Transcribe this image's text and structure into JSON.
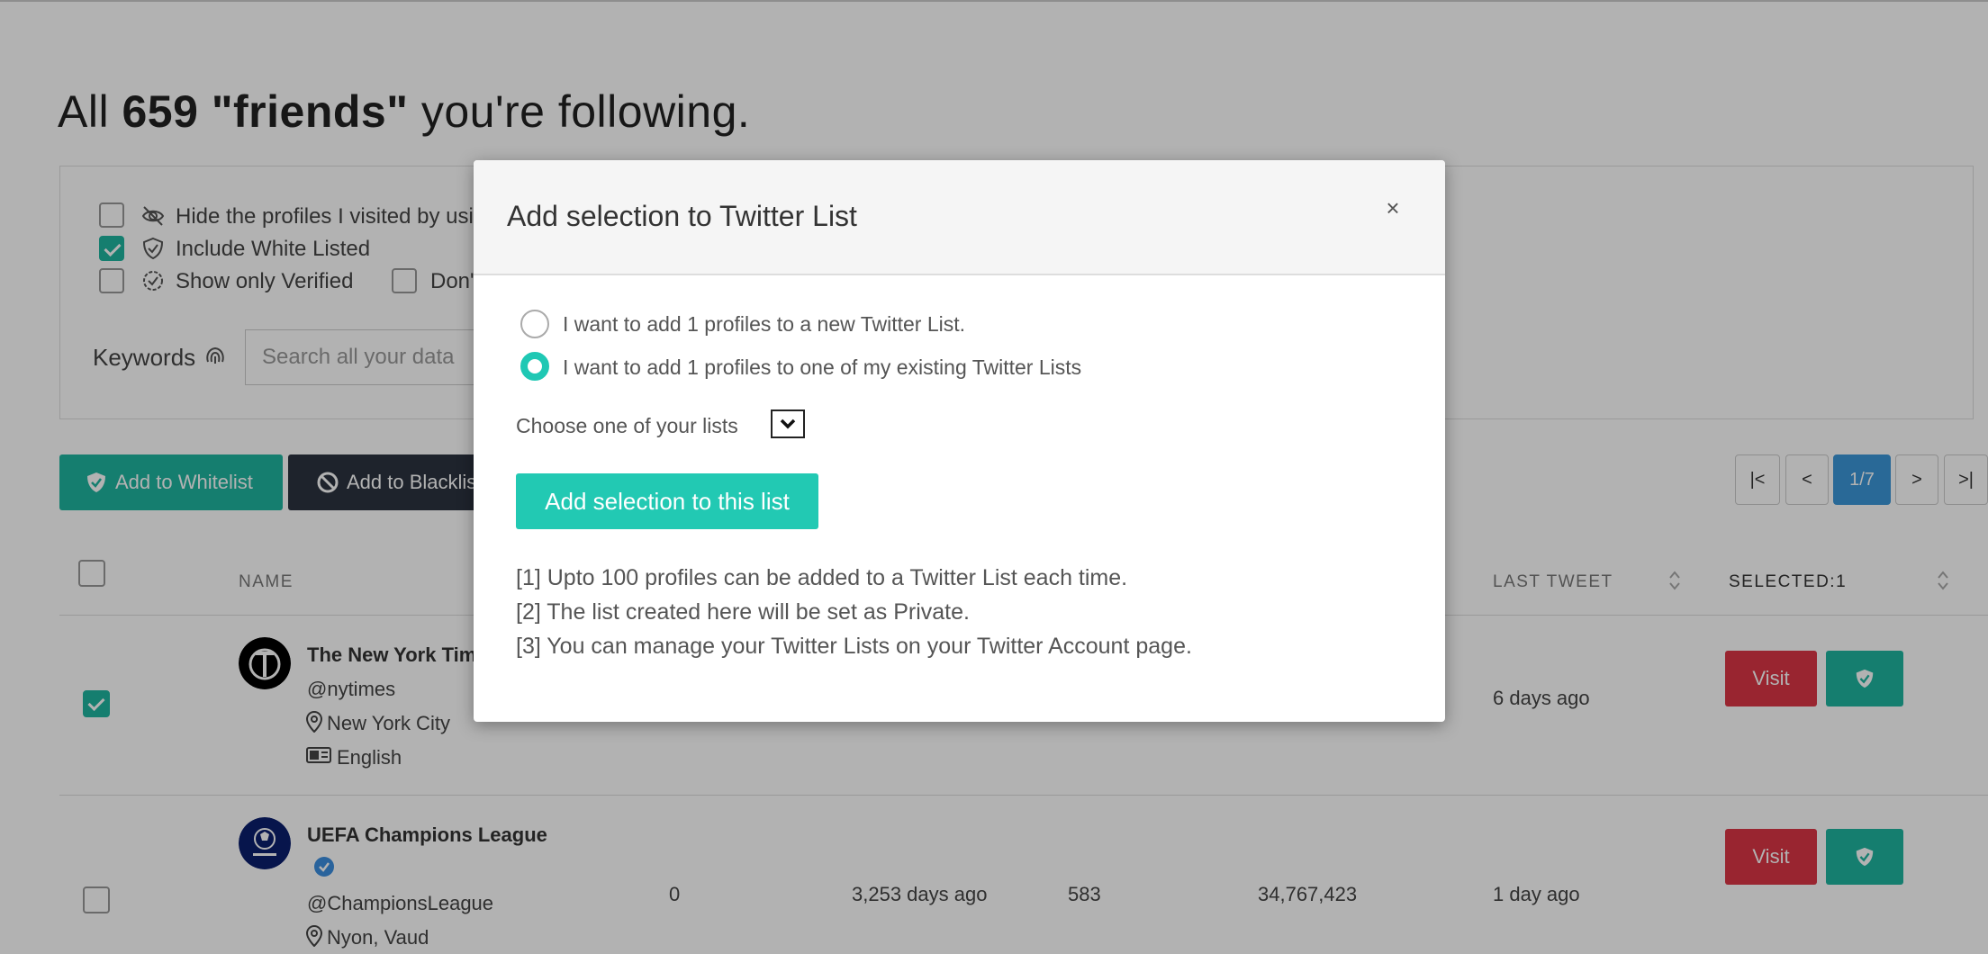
{
  "heading": {
    "pre": "All ",
    "count": "659",
    "mid": " ",
    "friends": "\"friends\"",
    "post": " you're following."
  },
  "filters": {
    "hide_visited": "Hide the profiles I visited by usi",
    "include_whitelisted": "Include White Listed",
    "verified_only": "Show only Verified",
    "dont": "Don'",
    "keywords_label": "Keywords",
    "search_placeholder": "Search all your data"
  },
  "actions": {
    "add_whitelist": "Add to Whitelist",
    "add_blacklist": "Add to Blacklist"
  },
  "pagination": {
    "first": "|<",
    "prev": "<",
    "current": "1/7",
    "next": ">",
    "last": ">|"
  },
  "table": {
    "headers": {
      "name": "NAME",
      "last_tweet": "LAST TWEET",
      "selected": "SELECTED:1"
    },
    "rows": [
      {
        "name": "The New York Tim",
        "handle": "@nytimes",
        "location": "New York City",
        "language": "English",
        "last_tweet": "6 days ago",
        "visit": "Visit",
        "checked": true
      },
      {
        "name": "UEFA Champions League",
        "handle": "@ChampionsLeague",
        "location": "Nyon, Vaud",
        "col1": "0",
        "col2": "3,253 days ago",
        "col3": "583",
        "col4": "34,767,423",
        "last_tweet": "1 day ago",
        "visit": "Visit",
        "checked": false
      }
    ]
  },
  "modal": {
    "title": "Add selection to Twitter List",
    "close": "×",
    "option_new": "I want to add 1 profiles to a new Twitter List.",
    "option_existing": "I want to add 1 profiles to one of my existing Twitter Lists",
    "choose_label": "Choose one of your lists",
    "add_button": "Add selection to this list",
    "notes": [
      "[1] Upto 100 profiles can be added to a Twitter List each time.",
      "[2] The list created here will be set as Private.",
      "[3] You can manage your Twitter Lists on your Twitter Account page."
    ]
  },
  "colors": {
    "accent": "#1fb5a0",
    "danger": "#dc3545",
    "pager_active": "#3b97d9",
    "dark": "#2b3340"
  }
}
